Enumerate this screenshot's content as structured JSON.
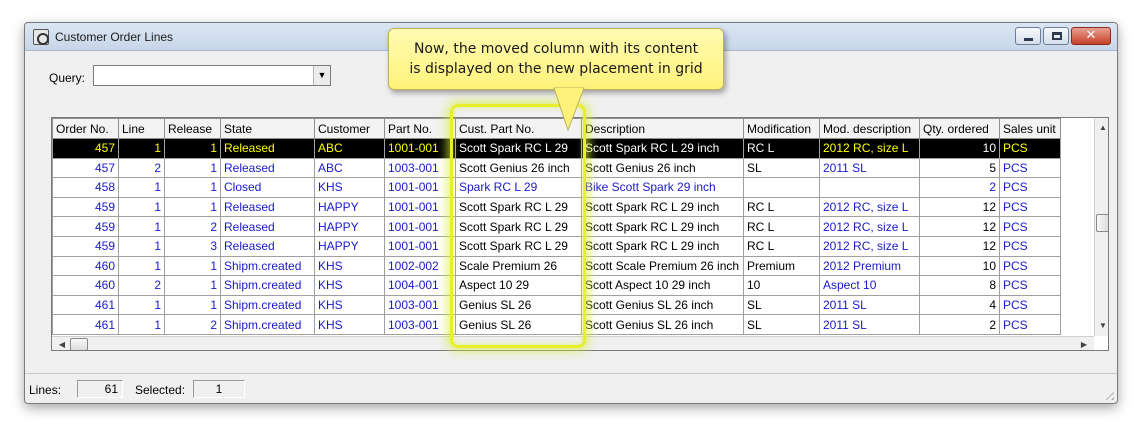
{
  "window": {
    "title": "Customer Order Lines",
    "icon": "customer-order-lines-icon"
  },
  "query": {
    "label": "Query:",
    "value": ""
  },
  "grid": {
    "columns": [
      "Order No.",
      "Line",
      "Release",
      "State",
      "Customer",
      "Part No.",
      "Cust. Part No.",
      "Description",
      "Modification",
      "Mod. description",
      "Qty. ordered",
      "Sales unit"
    ],
    "rows": [
      {
        "order": "457",
        "line": "1",
        "release": "1",
        "state": "Released",
        "customer": "ABC",
        "part": "1001-001",
        "cust_part": "Scott Spark RC L 29",
        "description": "Scott Spark RC L 29 inch",
        "mod": "RC L",
        "mod_desc": "2012 RC, size L",
        "qty": "10",
        "unit": "PCS"
      },
      {
        "order": "457",
        "line": "2",
        "release": "1",
        "state": "Released",
        "customer": "ABC",
        "part": "1003-001",
        "cust_part": "Scott Genius 26 inch",
        "description": "Scott Genius 26 inch",
        "mod": "SL",
        "mod_desc": "2011 SL",
        "qty": "5",
        "unit": "PCS"
      },
      {
        "order": "458",
        "line": "1",
        "release": "1",
        "state": "Closed",
        "customer": "KHS",
        "part": "1001-001",
        "cust_part": "Spark RC L 29",
        "description": "Bike Scott Spark 29 inch",
        "mod": "",
        "mod_desc": "",
        "qty": "2",
        "unit": "PCS"
      },
      {
        "order": "459",
        "line": "1",
        "release": "1",
        "state": "Released",
        "customer": "HAPPY",
        "part": "1001-001",
        "cust_part": "Scott Spark RC L 29",
        "description": "Scott Spark RC L 29 inch",
        "mod": "RC L",
        "mod_desc": "2012 RC, size L",
        "qty": "12",
        "unit": "PCS"
      },
      {
        "order": "459",
        "line": "1",
        "release": "2",
        "state": "Released",
        "customer": "HAPPY",
        "part": "1001-001",
        "cust_part": "Scott Spark RC L 29",
        "description": "Scott Spark RC L 29 inch",
        "mod": "RC L",
        "mod_desc": "2012 RC, size L",
        "qty": "12",
        "unit": "PCS"
      },
      {
        "order": "459",
        "line": "1",
        "release": "3",
        "state": "Released",
        "customer": "HAPPY",
        "part": "1001-001",
        "cust_part": "Scott Spark RC L 29",
        "description": "Scott Spark RC L 29 inch",
        "mod": "RC L",
        "mod_desc": "2012 RC, size L",
        "qty": "12",
        "unit": "PCS"
      },
      {
        "order": "460",
        "line": "1",
        "release": "1",
        "state": "Shipm.created",
        "customer": "KHS",
        "part": "1002-002",
        "cust_part": "Scale Premium 26",
        "description": "Scott Scale Premium 26 inch",
        "mod": "Premium",
        "mod_desc": "2012 Premium",
        "qty": "10",
        "unit": "PCS"
      },
      {
        "order": "460",
        "line": "2",
        "release": "1",
        "state": "Shipm.created",
        "customer": "KHS",
        "part": "1004-001",
        "cust_part": "Aspect 10 29",
        "description": "Scott Aspect 10 29 inch",
        "mod": "10",
        "mod_desc": "Aspect 10",
        "qty": "8",
        "unit": "PCS"
      },
      {
        "order": "461",
        "line": "1",
        "release": "1",
        "state": "Shipm.created",
        "customer": "KHS",
        "part": "1003-001",
        "cust_part": "Genius SL 26",
        "description": "Scott Genius SL 26 inch",
        "mod": "SL",
        "mod_desc": "2011 SL",
        "qty": "4",
        "unit": "PCS"
      },
      {
        "order": "461",
        "line": "1",
        "release": "2",
        "state": "Shipm.created",
        "customer": "KHS",
        "part": "1003-001",
        "cust_part": "Genius SL 26",
        "description": "Scott Genius SL 26 inch",
        "mod": "SL",
        "mod_desc": "2011 SL",
        "qty": "2",
        "unit": "PCS"
      }
    ]
  },
  "status": {
    "lines_label": "Lines:",
    "lines_value": "61",
    "selected_label": "Selected:",
    "selected_value": "1"
  },
  "callout": {
    "line1": "Now, the moved column with its content",
    "line2": "is displayed on the new placement in grid"
  },
  "colors": {
    "row_text": "#1a1acb",
    "selected_bg": "#000000",
    "selected_text": "#ffff00",
    "highlight": "#e8ef2a",
    "callout_bg": "#fff27a"
  }
}
